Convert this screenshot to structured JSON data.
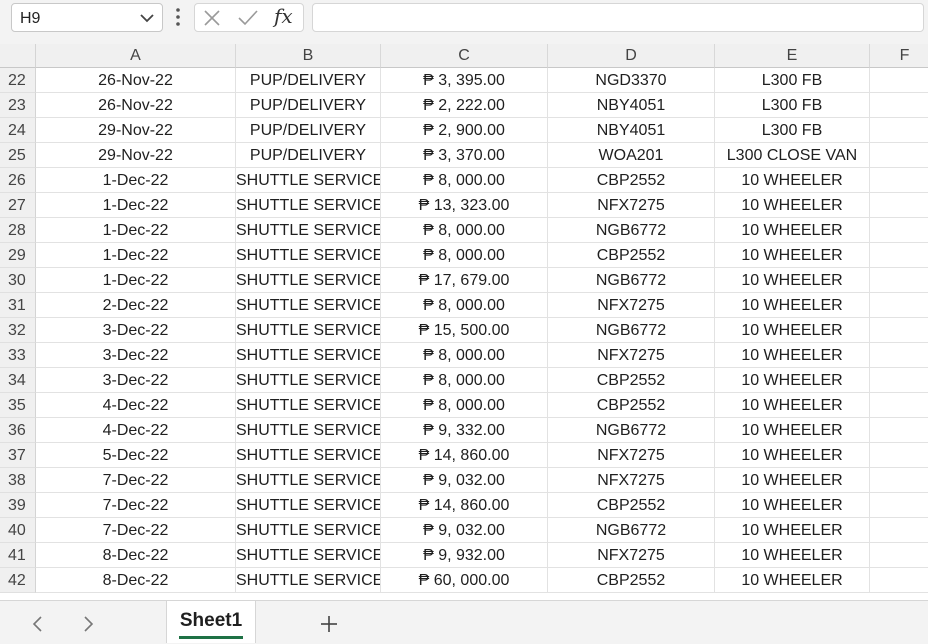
{
  "name_box": {
    "value": "H9"
  },
  "formula_bar": {
    "value": "",
    "fx_label": "fx"
  },
  "columns": [
    "A",
    "B",
    "C",
    "D",
    "E",
    "F"
  ],
  "rows": [
    {
      "num": "22",
      "cells": [
        "26-Nov-22",
        "PUP/DELIVERY",
        "₱ 3, 395.00",
        "NGD3370",
        "L300 FB",
        ""
      ]
    },
    {
      "num": "23",
      "cells": [
        "26-Nov-22",
        "PUP/DELIVERY",
        "₱ 2, 222.00",
        "NBY4051",
        "L300 FB",
        ""
      ]
    },
    {
      "num": "24",
      "cells": [
        "29-Nov-22",
        "PUP/DELIVERY",
        "₱ 2, 900.00",
        "NBY4051",
        "L300 FB",
        ""
      ]
    },
    {
      "num": "25",
      "cells": [
        "29-Nov-22",
        "PUP/DELIVERY",
        "₱ 3, 370.00",
        "WOA201",
        "L300 CLOSE VAN",
        ""
      ]
    },
    {
      "num": "26",
      "cells": [
        "1-Dec-22",
        "SHUTTLE SERVICE",
        "₱ 8, 000.00",
        "CBP2552",
        "10 WHEELER",
        ""
      ]
    },
    {
      "num": "27",
      "cells": [
        "1-Dec-22",
        "SHUTTLE SERVICE",
        "₱ 13, 323.00",
        "NFX7275",
        "10 WHEELER",
        ""
      ]
    },
    {
      "num": "28",
      "cells": [
        "1-Dec-22",
        "SHUTTLE SERVICE",
        "₱ 8, 000.00",
        "NGB6772",
        "10 WHEELER",
        ""
      ]
    },
    {
      "num": "29",
      "cells": [
        "1-Dec-22",
        "SHUTTLE SERVICE",
        "₱ 8, 000.00",
        "CBP2552",
        "10 WHEELER",
        ""
      ]
    },
    {
      "num": "30",
      "cells": [
        "1-Dec-22",
        "SHUTTLE SERVICE",
        "₱ 17, 679.00",
        "NGB6772",
        "10 WHEELER",
        ""
      ]
    },
    {
      "num": "31",
      "cells": [
        "2-Dec-22",
        "SHUTTLE SERVICE",
        "₱ 8, 000.00",
        "NFX7275",
        "10 WHEELER",
        ""
      ]
    },
    {
      "num": "32",
      "cells": [
        "3-Dec-22",
        "SHUTTLE SERVICE",
        "₱ 15, 500.00",
        "NGB6772",
        "10 WHEELER",
        ""
      ]
    },
    {
      "num": "33",
      "cells": [
        "3-Dec-22",
        "SHUTTLE SERVICE",
        "₱ 8, 000.00",
        "NFX7275",
        "10 WHEELER",
        ""
      ]
    },
    {
      "num": "34",
      "cells": [
        "3-Dec-22",
        "SHUTTLE SERVICE",
        "₱ 8, 000.00",
        "CBP2552",
        "10 WHEELER",
        ""
      ]
    },
    {
      "num": "35",
      "cells": [
        "4-Dec-22",
        "SHUTTLE SERVICE",
        "₱ 8, 000.00",
        "CBP2552",
        "10 WHEELER",
        ""
      ]
    },
    {
      "num": "36",
      "cells": [
        "4-Dec-22",
        "SHUTTLE SERVICE",
        "₱ 9, 332.00",
        "NGB6772",
        "10 WHEELER",
        ""
      ]
    },
    {
      "num": "37",
      "cells": [
        "5-Dec-22",
        "SHUTTLE SERVICE",
        "₱ 14, 860.00",
        "NFX7275",
        "10 WHEELER",
        ""
      ]
    },
    {
      "num": "38",
      "cells": [
        "7-Dec-22",
        "SHUTTLE SERVICE",
        "₱ 9, 032.00",
        "NFX7275",
        "10 WHEELER",
        ""
      ]
    },
    {
      "num": "39",
      "cells": [
        "7-Dec-22",
        "SHUTTLE SERVICE",
        "₱ 14, 860.00",
        "CBP2552",
        "10 WHEELER",
        ""
      ]
    },
    {
      "num": "40",
      "cells": [
        "7-Dec-22",
        "SHUTTLE SERVICE",
        "₱ 9, 032.00",
        "NGB6772",
        "10 WHEELER",
        ""
      ]
    },
    {
      "num": "41",
      "cells": [
        "8-Dec-22",
        "SHUTTLE SERVICE",
        "₱ 9, 932.00",
        "NFX7275",
        "10 WHEELER",
        ""
      ]
    },
    {
      "num": "42",
      "cells": [
        "8-Dec-22",
        "SHUTTLE SERVICE",
        "₱ 60, 000.00",
        "CBP2552",
        "10 WHEELER",
        ""
      ]
    }
  ],
  "sheet_tabs": [
    {
      "label": "Sheet1",
      "active": true
    }
  ],
  "colors": {
    "active_tab_accent": "#1e7145",
    "header_bg": "#f0f0f0",
    "gridline": "#e2e2e2"
  }
}
